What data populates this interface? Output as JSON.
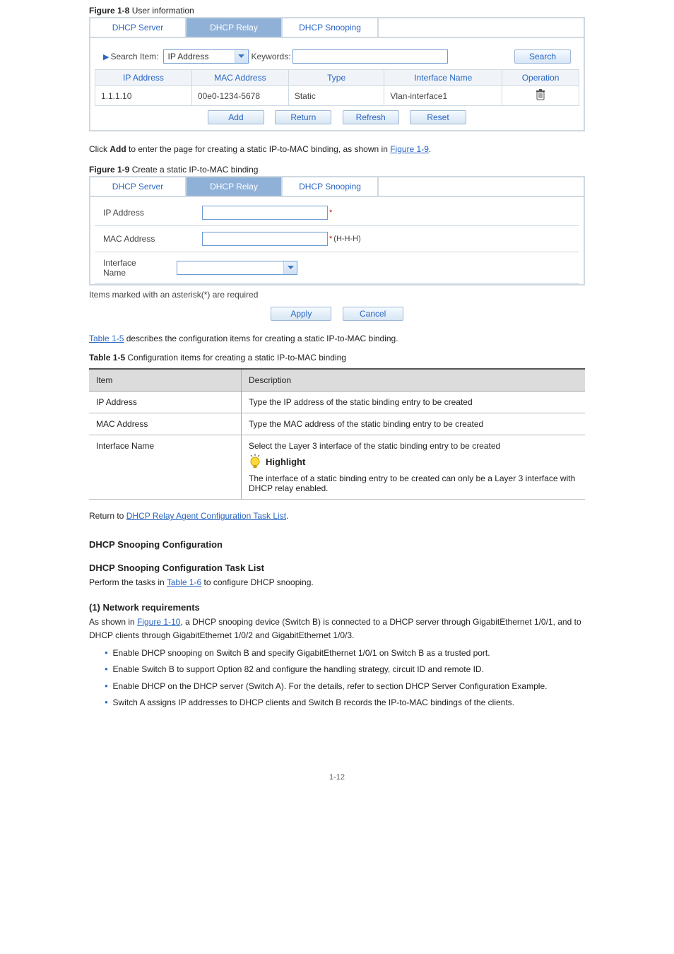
{
  "figures": {
    "fig18_caption_prefix": "Figure 1-8",
    "fig18_caption_text": "User information",
    "fig19_caption_prefix": "Figure 1-9",
    "fig19_caption_text": "Create a static IP-to-MAC binding"
  },
  "tabs": {
    "server": "DHCP Server",
    "relay": "DHCP Relay",
    "snooping": "DHCP Snooping"
  },
  "fig18": {
    "search_item_label": "Search Item:",
    "search_select_value": "IP Address",
    "keywords_label": "Keywords:",
    "search_btn": "Search",
    "cols": {
      "ip": "IP Address",
      "mac": "MAC Address",
      "type": "Type",
      "ifname": "Interface Name",
      "op": "Operation"
    },
    "row": {
      "ip": "1.1.1.10",
      "mac": "00e0-1234-5678",
      "type": "Static",
      "ifname": "Vlan-interface1"
    },
    "buttons": {
      "add": "Add",
      "return": "Return",
      "refresh": "Refresh",
      "reset": "Reset"
    }
  },
  "body_after_fig18": {
    "line1_a": "Click ",
    "line1_b": "Add",
    "line1_c": " to enter the page for creating a static IP-to-MAC binding, as shown in ",
    "line1_link": "Figure 1-9",
    "line1_d": "."
  },
  "fig19": {
    "ip_label": "IP Address",
    "mac_label": "MAC Address",
    "ifname_label": "Interface Name",
    "req_asterisk": "*",
    "hhh": "(H-H-H)",
    "reqnote": "Items marked with an asterisk(*) are required",
    "apply": "Apply",
    "cancel": "Cancel"
  },
  "tbl5": {
    "caption_link": "Table 1-5",
    "caption_rest": " describes the configuration items for creating a static IP-to-MAC binding.",
    "caption_prefix": "Table 1-5",
    "caption_text": "Configuration items for creating a static IP-to-MAC binding",
    "head_item": "Item",
    "head_desc": "Description",
    "rows": {
      "ip_item": "IP Address",
      "ip_desc": "Type the IP address of the static binding entry to be created",
      "mac_item": "MAC Address",
      "mac_desc": "Type the MAC address of the static binding entry to be created",
      "if_item": "Interface Name",
      "if_desc_line1": "Select the Layer 3 interface of the static binding entry to be created",
      "if_highlight": "Highlight",
      "if_desc_line2": "The interface of a static binding entry to be created can only be a Layer 3 interface with DHCP relay enabled."
    }
  },
  "return_text": {
    "a": "Return to ",
    "link": "DHCP Relay Agent Configuration Task List",
    "b": "."
  },
  "snoop": {
    "heading": "DHCP Snooping Configuration",
    "taskhdr": "DHCP Snooping Configuration Task List",
    "perform_a": "Perform the tasks in ",
    "perform_link": "Table 1-6",
    "perform_b": " to configure DHCP snooping.",
    "network_hdr": "(1)  Network requirements",
    "network_p1": "As shown in ",
    "network_link": "Figure 1-10",
    "network_p2": ", a DHCP snooping device (Switch B) is connected to a DHCP server through GigabitEthernet 1/0/1, and to DHCP clients through GigabitEthernet 1/0/2 and GigabitEthernet 1/0/3.",
    "bullets": [
      "Enable DHCP snooping on Switch B and specify GigabitEthernet 1/0/1 on Switch B as a trusted port.",
      "Enable Switch B to support Option 82 and configure the handling strategy, circuit ID and remote ID.",
      "Enable DHCP on the DHCP server (Switch A). For the details, refer to section DHCP Server Configuration Example.",
      "Switch A assigns IP addresses to DHCP clients and Switch B records the IP-to-MAC bindings of the clients."
    ]
  },
  "page_num": "1-12"
}
